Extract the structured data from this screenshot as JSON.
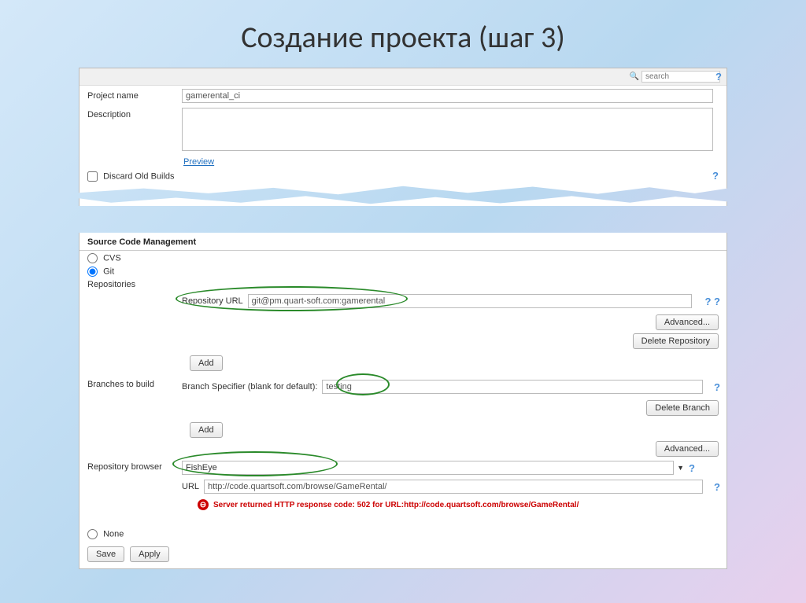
{
  "slide": {
    "title": "Создание проекта (шаг 3)"
  },
  "topbar": {
    "search_placeholder": "search"
  },
  "project": {
    "name_label": "Project name",
    "name_value": "gamerental_ci",
    "desc_label": "Description",
    "desc_value": "",
    "preview_link": "Preview",
    "discard_label": "Discard Old Builds"
  },
  "scm": {
    "header": "Source Code Management",
    "options": {
      "cvs": "CVS",
      "git": "Git",
      "none": "None"
    },
    "repos_label": "Repositories",
    "repo_url_label": "Repository URL",
    "repo_url_value": "git@pm.quart-soft.com:gamerental",
    "branches_label": "Branches to build",
    "branch_spec_label": "Branch Specifier (blank for default):",
    "branch_spec_value": "testing",
    "browser_label": "Repository browser",
    "browser_value": "FishEye",
    "browser_url_label": "URL",
    "browser_url_value": "http://code.quartsoft.com/browse/GameRental/",
    "error_text": "Server returned HTTP response code: 502 for URL: ",
    "error_url": "http://code.quartsoft.com/browse/GameRental/"
  },
  "buttons": {
    "advanced": "Advanced...",
    "delete_repo": "Delete Repository",
    "delete_branch": "Delete Branch",
    "add": "Add",
    "save": "Save",
    "apply": "Apply"
  }
}
